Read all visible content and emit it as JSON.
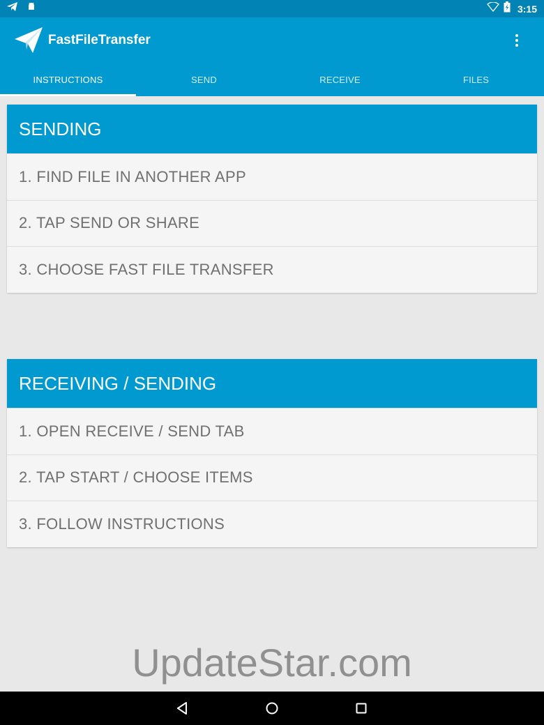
{
  "status_bar": {
    "time": "3:15",
    "icons": [
      "telegram-icon",
      "android-debug-icon",
      "wifi-icon",
      "battery-icon"
    ]
  },
  "app": {
    "title": "FastFileTransfer",
    "logo_icon": "paper-plane-icon",
    "menu_icon": "overflow-menu-icon",
    "bar_color": "#019ad0",
    "status_color": "#0184b5"
  },
  "tabs": [
    {
      "label": "INSTRUCTIONS",
      "active": true
    },
    {
      "label": "SEND",
      "active": false
    },
    {
      "label": "RECEIVE",
      "active": false
    },
    {
      "label": "FILES",
      "active": false
    }
  ],
  "sections": [
    {
      "title": "SENDING",
      "items": [
        "1. FIND FILE IN ANOTHER APP",
        "2. TAP SEND OR SHARE",
        "3. CHOOSE FAST FILE TRANSFER"
      ]
    },
    {
      "title": "RECEIVING / SENDING",
      "items": [
        "1. OPEN RECEIVE / SEND TAB",
        "2. TAP START / CHOOSE ITEMS",
        "3. FOLLOW INSTRUCTIONS"
      ]
    }
  ],
  "watermark": "UpdateStar.com",
  "nav_bar": {
    "icons": [
      "back-icon",
      "home-icon",
      "recents-icon"
    ]
  }
}
